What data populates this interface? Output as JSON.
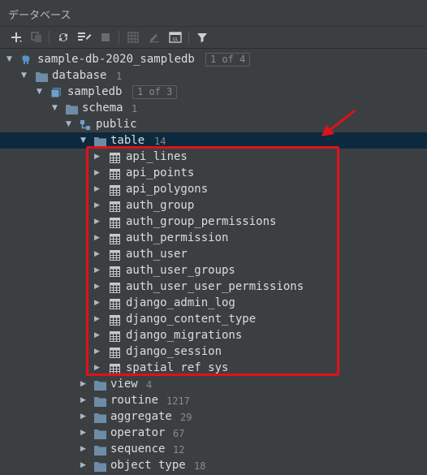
{
  "panel": {
    "title": "データベース"
  },
  "toolbar": {
    "buttons": [
      "add-icon",
      "duplicate-icon",
      "refresh-icon",
      "schema-settings-icon",
      "stop-icon",
      "table-editor-icon",
      "edit-icon",
      "sql-console-icon",
      "filter-icon"
    ]
  },
  "tree": {
    "root": {
      "label": "sample-db-2020_sampledb",
      "badge": "1 of 4"
    },
    "database": {
      "label": "database",
      "count": "1"
    },
    "sampledb": {
      "label": "sampledb",
      "badge": "1 of 3"
    },
    "schema": {
      "label": "schema",
      "count": "1"
    },
    "public": {
      "label": "public"
    },
    "table": {
      "label": "table",
      "count": "14"
    },
    "tables": [
      "api_lines",
      "api_points",
      "api_polygons",
      "auth_group",
      "auth_group_permissions",
      "auth_permission",
      "auth_user",
      "auth_user_groups",
      "auth_user_user_permissions",
      "django_admin_log",
      "django_content_type",
      "django_migrations",
      "django_session",
      "spatial_ref_sys"
    ],
    "folders": [
      {
        "label": "view",
        "count": "4"
      },
      {
        "label": "routine",
        "count": "1217"
      },
      {
        "label": "aggregate",
        "count": "29"
      },
      {
        "label": "operator",
        "count": "67"
      },
      {
        "label": "sequence",
        "count": "12"
      },
      {
        "label": "object type",
        "count": "18"
      }
    ]
  },
  "colors": {
    "background": "#3c3f41",
    "selection": "#0d293e",
    "folder": "#6e8ca8",
    "annotation": "#e0111a"
  }
}
